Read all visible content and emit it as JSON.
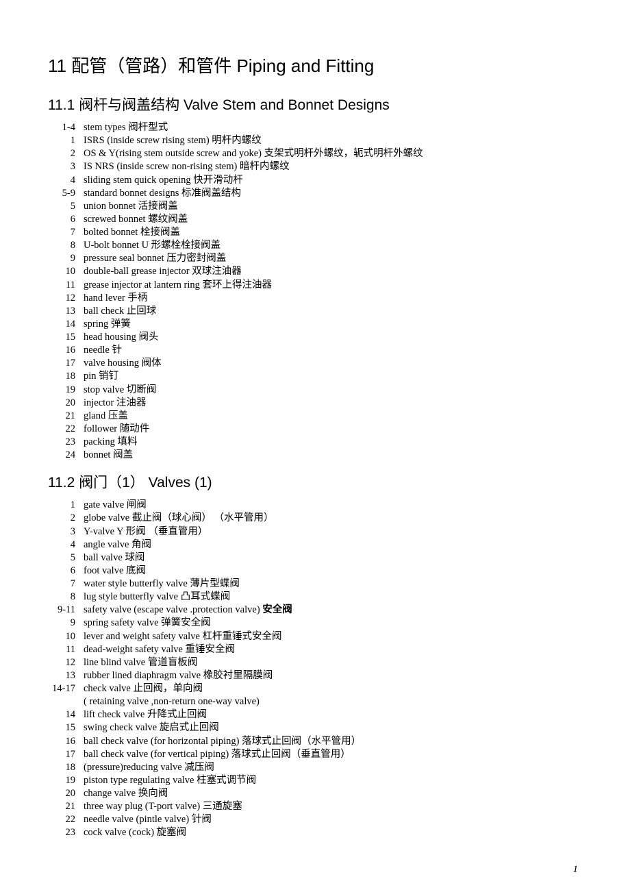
{
  "title": "11  配管（管路）和管件    Piping and Fitting",
  "sections": [
    {
      "heading": "11.1  阀杆与阀盖结构    Valve Stem and Bonnet Designs",
      "items": [
        {
          "num": "1-4",
          "text": "stem   types      阀杆型式"
        },
        {
          "num": "1",
          "text": "ISRS (inside screw rising stem)    明杆内螺纹"
        },
        {
          "num": "2",
          "text": "OS & Y(rising stem outside screw and yoke)    支架式明杆外螺纹，轭式明杆外螺纹",
          "wrap": true
        },
        {
          "num": "3",
          "text": "IS NRS (inside screw non-rising stem)    暗杆内螺纹"
        },
        {
          "num": "4",
          "text": "sliding stem quick opening    快开滑动杆"
        },
        {
          "num": "5-9",
          "text": "standard bonnet designs     标准阀盖结构"
        },
        {
          "num": "5",
          "text": "union bonnet   活接阀盖"
        },
        {
          "num": "6",
          "text": "screwed bonnet   螺纹阀盖"
        },
        {
          "num": "7",
          "text": "bolted bonnet    栓接阀盖"
        },
        {
          "num": "8",
          "text": "U-bolt bonnet   U 形螺栓栓接阀盖"
        },
        {
          "num": "9",
          "text": "pressure seal bonnet   压力密封阀盖"
        },
        {
          "num": "10",
          "text": "double-ball grease injector    双球注油器"
        },
        {
          "num": "11",
          "text": "grease injector at lantern ring    套环上得注油器"
        },
        {
          "num": "12",
          "text": "hand lever   手柄"
        },
        {
          "num": "13",
          "text": "ball check    止回球"
        },
        {
          "num": "14",
          "text": "spring   弹簧"
        },
        {
          "num": "15",
          "text": "head housing    阀头"
        },
        {
          "num": "16",
          "text": "needle   针"
        },
        {
          "num": "17",
          "text": "valve housing    阀体"
        },
        {
          "num": "18",
          "text": "pin   销钉"
        },
        {
          "num": "19",
          "text": "stop valve   切断阀"
        },
        {
          "num": "20",
          "text": "injector   注油器"
        },
        {
          "num": "21",
          "text": "gland   压盖"
        },
        {
          "num": "22",
          "text": "follower   随动件"
        },
        {
          "num": "23",
          "text": "packing   填料"
        },
        {
          "num": "24",
          "text": "bonnet   阀盖"
        }
      ]
    },
    {
      "heading": "11.2  阀门（1）     Valves (1)",
      "items": [
        {
          "num": "1",
          "text": "gate valve   闸阀"
        },
        {
          "num": "2",
          "text": "globe valve   截止阀（球心阀）              （水平管用）"
        },
        {
          "num": "3",
          "text": "Y-valve   Y 形阀                               （垂直管用）"
        },
        {
          "num": "4",
          "text": "angle valve    角阀"
        },
        {
          "num": "5",
          "text": "ball valve   球阀"
        },
        {
          "num": "6",
          "text": "foot valve   底阀"
        },
        {
          "num": "7",
          "text": "water style butterfly valve    薄片型蝶阀"
        },
        {
          "num": "8",
          "text": "lug style butterfly valve    凸耳式蝶阀"
        },
        {
          "num": "9-11",
          "text": "safety valve (escape valve .protection valve)    <b>安全阀</b>",
          "html": true
        },
        {
          "num": "9",
          "text": "spring safety valve   弹簧安全阀"
        },
        {
          "num": "10",
          "text": "lever and weight safety valve   杠杆重锤式安全阀"
        },
        {
          "num": "11",
          "text": "dead-weight safety valve   重锤安全阀"
        },
        {
          "num": "12",
          "text": "line blind valve    管道盲板阀"
        },
        {
          "num": "13",
          "text": "rubber lined diaphragm valve   橡胶衬里隔膜阀"
        },
        {
          "num": "14-17",
          "text": "check valve   止回阀，单向阀"
        },
        {
          "num": "",
          "text": "( retaining valve ,non-return one-way valve)"
        },
        {
          "num": "14",
          "text": "lift check valve   升降式止回阀"
        },
        {
          "num": "15",
          "text": "swing check valve   旋启式止回阀"
        },
        {
          "num": "16",
          "text": "ball check valve (for horizontal piping)    落球式止回阀（水平管用）"
        },
        {
          "num": "17",
          "text": "ball check valve (for vertical piping)    落球式止回阀（垂直管用）"
        },
        {
          "num": "18",
          "text": "(pressure)reducing valve    减压阀"
        },
        {
          "num": "19",
          "text": "piston type regulating valve    柱塞式调节阀"
        },
        {
          "num": "20",
          "text": "change valve   换向阀"
        },
        {
          "num": "21",
          "text": "three way plug (T-port valve)    三通旋塞"
        },
        {
          "num": "22",
          "text": "needle valve (pintle valve)    针阀"
        },
        {
          "num": "23",
          "text": "cock valve (cock)   旋塞阀"
        }
      ]
    }
  ],
  "pageNumber": "1"
}
